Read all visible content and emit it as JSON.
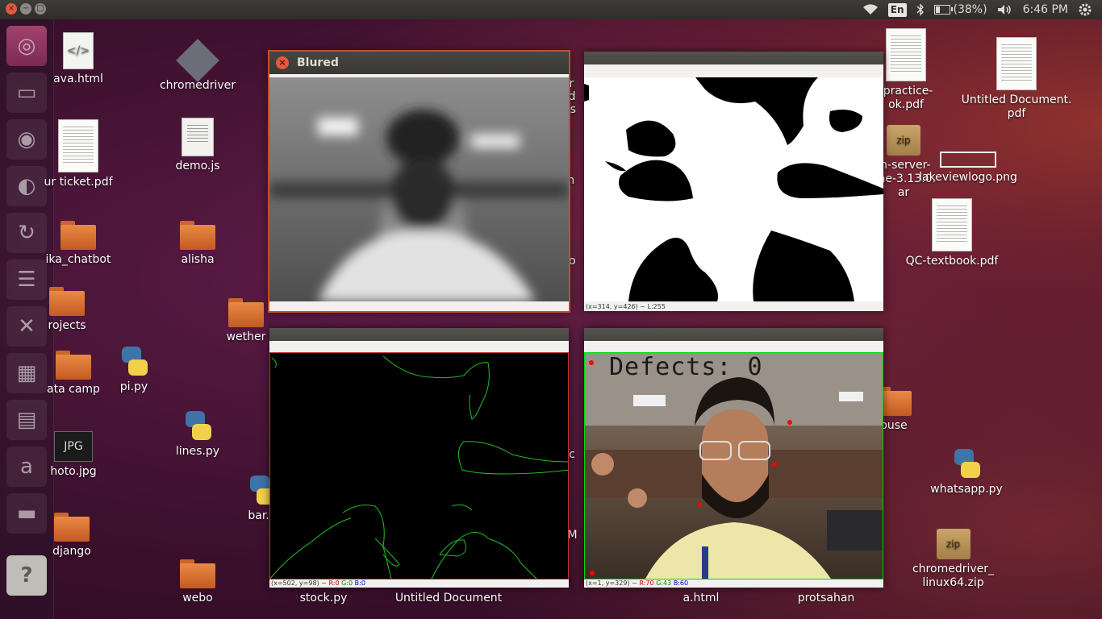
{
  "topbar": {
    "window_close": "×",
    "window_min": "−",
    "window_max": "□",
    "lang": "En",
    "battery": "(38%)",
    "battery_level": 0.38,
    "time": "6:46 PM",
    "icons": [
      "wifi-icon",
      "keyboard-lang-icon",
      "bluetooth-icon",
      "battery-icon",
      "volume-icon",
      "settings-gear-icon"
    ]
  },
  "launcher": {
    "apps": [
      "ubuntu-dash-icon",
      "files-icon",
      "chromium-icon",
      "browser-icon",
      "updater-icon",
      "writer-icon",
      "vscode-icon",
      "calc-icon",
      "impress-icon",
      "amazon-icon",
      "help-icon"
    ],
    "help_label": "?"
  },
  "desktop": {
    "icons": [
      {
        "label": "ava.html",
        "type": "code"
      },
      {
        "label": "chromedriver",
        "type": "crx"
      },
      {
        "label": "ur ticket.pdf",
        "type": "pdf"
      },
      {
        "label": "demo.js",
        "type": "doc"
      },
      {
        "label": "ika_chatbot",
        "type": "folder"
      },
      {
        "label": "alisha",
        "type": "folder"
      },
      {
        "label": "rojects",
        "type": "folder"
      },
      {
        "label": "wether",
        "type": "folder"
      },
      {
        "label": "ata camp",
        "type": "folder"
      },
      {
        "label": "pi.py",
        "type": "py"
      },
      {
        "label": "hoto.jpg",
        "type": "jpg"
      },
      {
        "label": "lines.py",
        "type": "py"
      },
      {
        "label": "bar.p",
        "type": "py"
      },
      {
        "label": "django",
        "type": "folder"
      },
      {
        "label": "webo",
        "type": "folder"
      },
      {
        "label": "stock.py",
        "type": "py"
      },
      {
        "label": "Untitled Document",
        "type": "doc"
      },
      {
        "label": "a.html",
        "type": "code"
      },
      {
        "label": "protsahan",
        "type": "folder"
      },
      {
        "label": "-practice-\nok.pdf",
        "type": "pdf"
      },
      {
        "label": "Untitled Document.\npdf",
        "type": "pdf"
      },
      {
        "label": "m-server-\none-3.13.0.\nar",
        "type": "zip"
      },
      {
        "label": "lakeviewlogo.png",
        "type": "logo"
      },
      {
        "label": "QC-textbook.pdf",
        "type": "pdf"
      },
      {
        "label": "ouse",
        "type": "folder"
      },
      {
        "label": "whatsapp.py",
        "type": "py"
      },
      {
        "label": "chromedriver_\nlinux64.zip",
        "type": "zip"
      }
    ],
    "partial_labels": [
      "ur",
      "Ud",
      "las",
      "sh",
      "Do",
      "1",
      "-fc",
      "OM"
    ],
    "jpg_badge": "JPG",
    "zip_badge": "zip"
  },
  "windows": {
    "blured": {
      "title": "Blured",
      "close": "×"
    },
    "threshold": {
      "status": "(x=314, y=426) ~ L:255"
    },
    "contours": {
      "status_prefix": "(x=502, y=98) ~",
      "r": "R:0",
      "g": "G:0",
      "b": "B:0"
    },
    "defects": {
      "overlay": "Defects: 0",
      "status_prefix": "(x=1, y=329) ~",
      "r": "R:70",
      "g": "G:43",
      "b": "B:60"
    }
  },
  "colors": {
    "accent": "#e8573a",
    "contour": "#22c022",
    "point": "#ff0000",
    "frame": "#00dd00"
  }
}
